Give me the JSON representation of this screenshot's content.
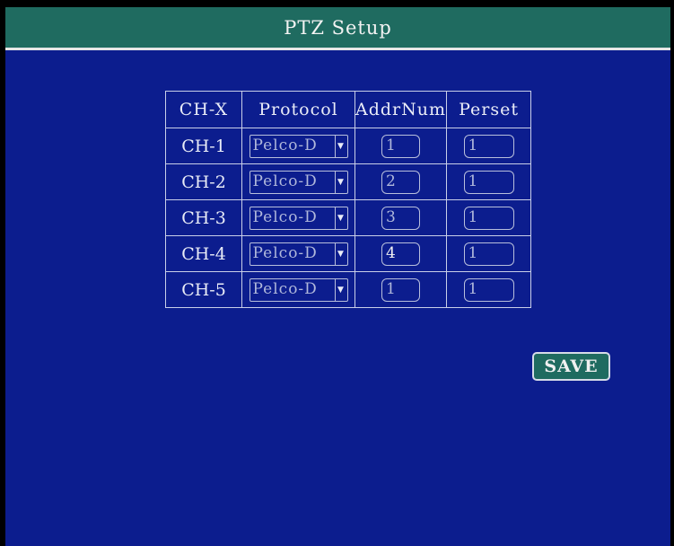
{
  "window": {
    "title": "PTZ Setup"
  },
  "table": {
    "headers": [
      "CH-X",
      "Protocol",
      "AddrNum",
      "Perset"
    ],
    "rows": [
      {
        "channel": "CH-1",
        "protocol": "Pelco-D",
        "addr": "1",
        "preset": "1"
      },
      {
        "channel": "CH-2",
        "protocol": "Pelco-D",
        "addr": "2",
        "preset": "1"
      },
      {
        "channel": "CH-3",
        "protocol": "Pelco-D",
        "addr": "3",
        "preset": "1"
      },
      {
        "channel": "CH-4",
        "protocol": "Pelco-D",
        "addr": "4",
        "preset": "1"
      },
      {
        "channel": "CH-5",
        "protocol": "Pelco-D",
        "addr": "1",
        "preset": "1"
      }
    ]
  },
  "actions": {
    "save_label": "SAVE"
  },
  "icons": {
    "dropdown": "chevron-down-icon"
  },
  "colors": {
    "background": "#0c1d8e",
    "title_bar": "#1f6b60",
    "border": "#c9cfe8"
  }
}
